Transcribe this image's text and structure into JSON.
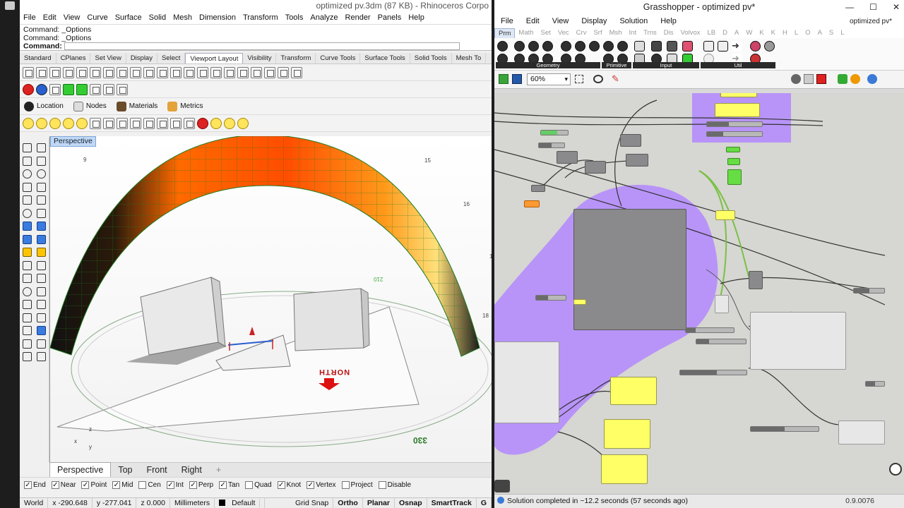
{
  "rhino": {
    "title": "optimized pv.3dm (87 KB) - Rhinoceros Corpo",
    "menu": [
      "File",
      "Edit",
      "View",
      "Curve",
      "Surface",
      "Solid",
      "Mesh",
      "Dimension",
      "Transform",
      "Tools",
      "Analyze",
      "Render",
      "Panels",
      "Help"
    ],
    "command_history": [
      "Command: _Options",
      "Command: _Options"
    ],
    "command_prompt": "Command:",
    "toolbar_tabs": [
      "Standard",
      "CPlanes",
      "Set View",
      "Display",
      "Select",
      "Viewport Layout",
      "Visibility",
      "Transform",
      "Curve Tools",
      "Surface Tools",
      "Solid Tools",
      "Mesh To"
    ],
    "active_tab": "Viewport Layout",
    "panel_tabs": [
      "Location",
      "Nodes",
      "Materials",
      "Metrics"
    ],
    "viewport_label": "Perspective",
    "viewport_tabs": [
      "Perspective",
      "Top",
      "Front",
      "Right"
    ],
    "viewport_tab_add": "+",
    "viewport_annotations": {
      "n9": "9",
      "n15": "15",
      "n16": "16",
      "n17": "17",
      "n18": "18",
      "n330": "330",
      "north": "NORTH",
      "n210": "210",
      "axis_x": "x",
      "axis_y": "y",
      "axis_z": "z"
    },
    "osnaps": [
      {
        "label": "End",
        "checked": true
      },
      {
        "label": "Near",
        "checked": true
      },
      {
        "label": "Point",
        "checked": true
      },
      {
        "label": "Mid",
        "checked": true
      },
      {
        "label": "Cen",
        "checked": false
      },
      {
        "label": "Int",
        "checked": true
      },
      {
        "label": "Perp",
        "checked": true
      },
      {
        "label": "Tan",
        "checked": true
      },
      {
        "label": "Quad",
        "checked": false
      },
      {
        "label": "Knot",
        "checked": true
      },
      {
        "label": "Vertex",
        "checked": true
      },
      {
        "label": "Project",
        "checked": false
      },
      {
        "label": "Disable",
        "checked": false
      }
    ],
    "status": {
      "cplane": "World",
      "x": "x -290.648",
      "y": "y -277.041",
      "z": "z 0.000",
      "units": "Millimeters",
      "layer": "Default",
      "grid_snap": "Grid Snap",
      "ortho": "Ortho",
      "planar": "Planar",
      "osnap": "Osnap",
      "smarttrack": "SmartTrack",
      "gumball": "G"
    }
  },
  "grasshopper": {
    "title": "Grasshopper - optimized pv*",
    "menu": [
      "File",
      "Edit",
      "View",
      "Display",
      "Solution",
      "Help"
    ],
    "document_name": "optimized pv*",
    "component_tabs": [
      "Prm",
      "Math",
      "Set",
      "Vec",
      "Crv",
      "Srf",
      "Msh",
      "Int",
      "Trns",
      "Dis",
      "Volvox",
      "LB",
      "D",
      "A",
      "W",
      "K",
      "K",
      "H",
      "L",
      "O",
      "A",
      "S",
      "L"
    ],
    "active_component_tab": "Prm",
    "ribbon_groups": [
      "Geometry",
      "Primitive",
      "Input",
      "Util"
    ],
    "zoom": "60%",
    "status_text": "Solution completed in ~12.2 seconds (57 seconds ago)",
    "version": "0.9.0076"
  },
  "colors": {
    "gh_group": "#b388ff",
    "gh_panel": "#ffff66",
    "gh_component": "#8a8a8c",
    "heat_hot": "#ff5a00",
    "heat_warm": "#ffd23c"
  }
}
